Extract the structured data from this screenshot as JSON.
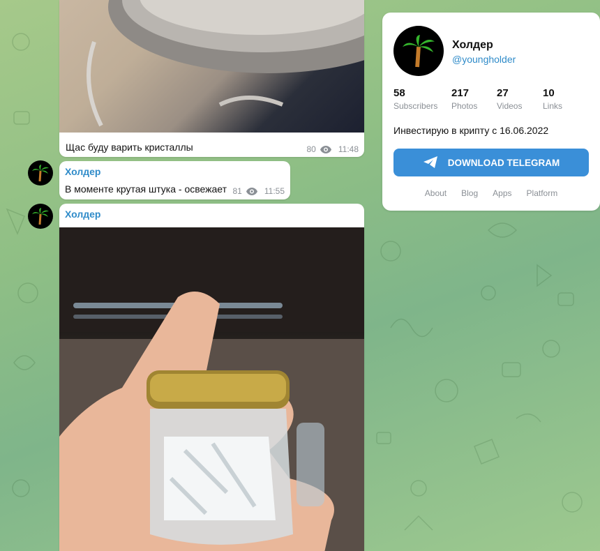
{
  "channel": {
    "name": "Холдер",
    "handle": "@youngholder",
    "description": "Инвестирую в крипту с 16.06.2022",
    "stats": [
      {
        "value": "58",
        "label": "Subscribers"
      },
      {
        "value": "217",
        "label": "Photos"
      },
      {
        "value": "27",
        "label": "Videos"
      },
      {
        "value": "10",
        "label": "Links"
      }
    ],
    "download_label": "DOWNLOAD TELEGRAM",
    "footer_links": [
      "About",
      "Blog",
      "Apps",
      "Platform"
    ]
  },
  "messages": [
    {
      "text": "Щас буду варить кристаллы",
      "views": "80",
      "time": "11:48"
    },
    {
      "author": "Холдер",
      "text": "В моменте крутая штука - освежает",
      "views": "81",
      "time": "11:55"
    },
    {
      "author": "Холдер"
    }
  ],
  "colors": {
    "accent": "#2f8bc9",
    "button": "#3a8fd8",
    "background": "#8fbf85"
  },
  "icons": {
    "views": "eye-icon",
    "avatar": "palm-tree-icon",
    "download": "telegram-plane-icon"
  }
}
